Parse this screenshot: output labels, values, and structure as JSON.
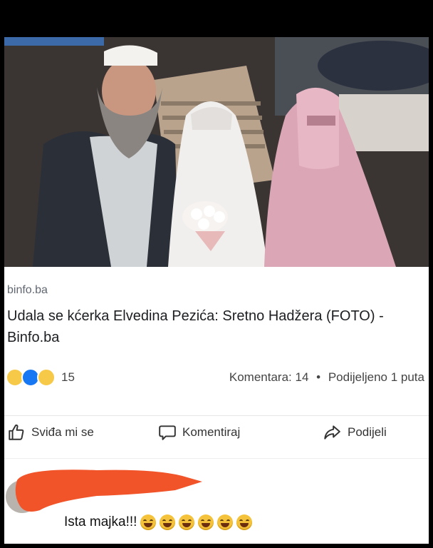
{
  "post": {
    "image_alt": "wedding photo",
    "link": {
      "domain": "binfo.ba",
      "headline": "Udala se kćerka Elvedina Pezića: Sretno Hadžera (FOTO) - Binfo.ba"
    },
    "stats": {
      "reaction_icons": [
        "haha-icon",
        "like-icon",
        "wow-icon"
      ],
      "reaction_count": "15",
      "comments": "Komentara: 14",
      "separator": "•",
      "shares": "Podijeljeno 1 puta"
    },
    "actions": {
      "like": "Sviđa mi se",
      "comment": "Komentiraj",
      "share": "Podijeli"
    },
    "comment": {
      "text": "Ista majka!!!",
      "emoji_icons": [
        "laugh-emoji",
        "laugh-emoji",
        "laugh-emoji",
        "laugh-emoji",
        "laugh-emoji",
        "laugh-emoji"
      ]
    }
  },
  "colors": {
    "redaction": "#f2542a",
    "like_blue": "#1877f2",
    "emoji_yellow": "#f5c33b"
  }
}
